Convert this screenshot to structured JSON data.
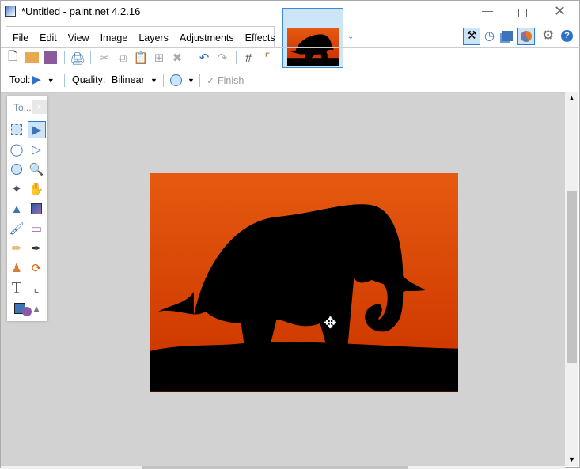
{
  "window": {
    "title": "*Untitled - paint.net 4.2.16"
  },
  "menu": [
    "File",
    "Edit",
    "View",
    "Image",
    "Layers",
    "Adjustments",
    "Effects"
  ],
  "toolbar": {
    "tool_label": "Tool:",
    "quality_label": "Quality:",
    "quality_value": "Bilinear",
    "finish_label": "Finish"
  },
  "toolbox": {
    "title": "To...",
    "close": "x"
  },
  "icons": {
    "app": "paintnet-icon",
    "minimize": "minimize-icon",
    "maximize": "maximize-icon",
    "close": "close-icon"
  },
  "colors": {
    "accent": "#2b7bd0",
    "sky_top": "#e55a10",
    "sky_bottom": "#c82a00"
  }
}
